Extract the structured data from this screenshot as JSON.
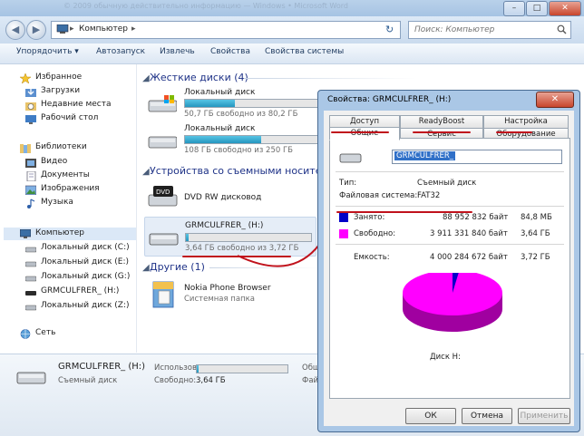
{
  "window": {
    "title_faded": "© 2009 обычную действительно информацию — Windows • Microsoft Word",
    "caption_buttons": [
      "–",
      "□",
      "✕"
    ]
  },
  "address_bar": {
    "back": "◀",
    "forward": "▶",
    "breadcrumb": "Компьютер",
    "separator": "▸",
    "refresh": "↻",
    "search_placeholder": "Поиск: Компьютер"
  },
  "toolbar": {
    "items": [
      "Упорядочить ▾",
      "Автозапуск",
      "Извлечь",
      "Свойства",
      "Свойства системы"
    ]
  },
  "nav_pane": {
    "favorites_header": "Избранное",
    "favorites": [
      "Загрузки",
      "Недавние места",
      "Рабочий стол"
    ],
    "libraries_header": "Библиотеки",
    "libraries": [
      "Видео",
      "Документы",
      "Изображения",
      "Музыка"
    ],
    "computer_header": "Компьютер",
    "computer_items": [
      "Локальный диск (C:)",
      "Локальный диск (E:)",
      "Локальный диск (G:)",
      "GRMCULFRER_ (H:)",
      "Локальный диск (Z:)"
    ],
    "network": "Сеть"
  },
  "content": {
    "hard_disks_header": "Жесткие диски (4)",
    "drives": [
      {
        "name": "Локальный диск",
        "free_text": "50,7 ГБ свободно из 80,2 ГБ",
        "used_fraction": 0.37
      },
      {
        "name": "Локальный диск",
        "free_text": "108 ГБ свободно из 250 ГБ",
        "used_fraction": 0.57
      }
    ],
    "removable_header": "Устройства со съемными носителями",
    "dvd_name": "DVD RW дисковод",
    "usb_name": "GRMCULFRER_ (H:)",
    "usb_free_text": "3,64 ГБ свободно из 3,72 ГБ",
    "usb_used_fraction": 0.02,
    "other_header": "Другие (1)",
    "nokia_name": "Nokia Phone Browser",
    "nokia_type": "Системная папка"
  },
  "details_pane": {
    "name": "GRMCULFRER_ (H:)",
    "type": "Съемный диск",
    "used_label": "Использовано:",
    "free_label": "Свободно:",
    "free_value": "3,64 ГБ",
    "used_fraction": 0.02,
    "cut_label": "Общ",
    "cut_label2": "Фай"
  },
  "dialog": {
    "title": "Свойства: GRMCULFRER_ (H:)",
    "close": "✕",
    "tabs_row1": [
      "Доступ",
      "ReadyBoost",
      "Настройка"
    ],
    "tabs_row2": [
      "Общие",
      "Сервис",
      "Оборудование"
    ],
    "volume_label": "GRMCULFRER_",
    "type_label": "Тип:",
    "type_value": "Съемный диск",
    "fs_label": "Файловая система:",
    "fs_value": "FAT32",
    "used_label": "Занято:",
    "used_bytes": "88 952 832 байт",
    "used_size": "84,8 МБ",
    "free_label": "Свободно:",
    "free_bytes": "3 911 331 840 байт",
    "free_size": "3,64 ГБ",
    "capacity_label": "Емкость:",
    "capacity_bytes": "4 000 284 672 байт",
    "capacity_size": "3,72 ГБ",
    "disk_caption": "Диск H:",
    "used_color": "#0000c8",
    "free_color": "#ff00ff",
    "used_fraction": 0.022,
    "buttons": [
      "ОК",
      "Отмена",
      "Применить"
    ]
  }
}
